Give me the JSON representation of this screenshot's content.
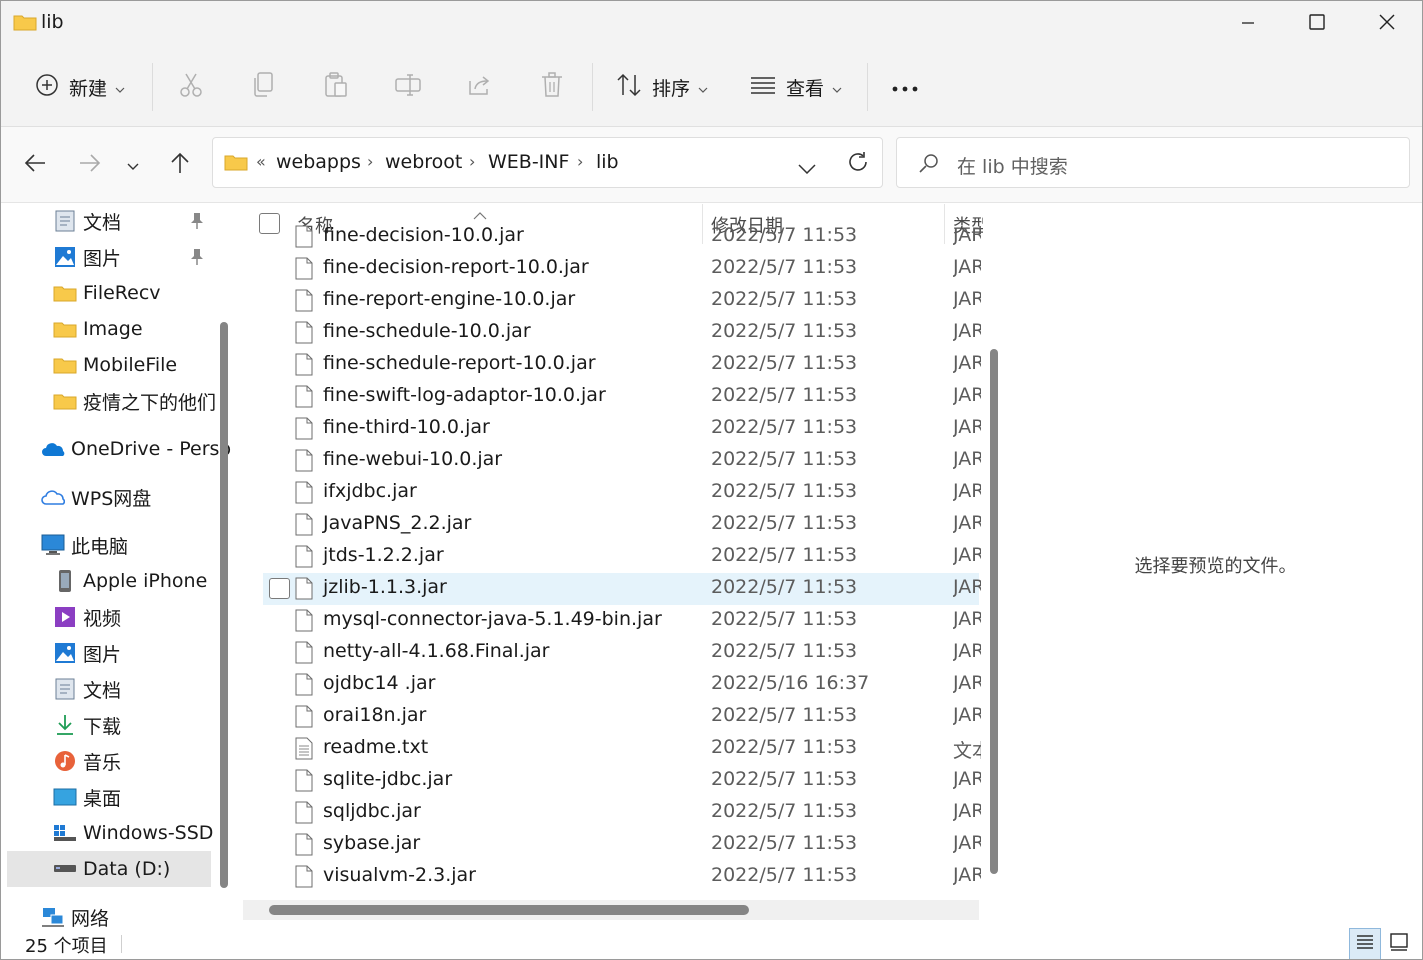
{
  "window": {
    "title": "lib"
  },
  "toolbar": {
    "new_label": "新建",
    "sort_label": "排序",
    "view_label": "查看"
  },
  "address": {
    "overflow": "«",
    "crumbs": [
      "webapps",
      "webroot",
      "WEB-INF",
      "lib"
    ]
  },
  "search": {
    "placeholder": "在 lib 中搜索"
  },
  "nav": {
    "items": [
      {
        "label": "文档",
        "icon": "documents-icon",
        "pinned": true
      },
      {
        "label": "图片",
        "icon": "pictures-icon",
        "pinned": true
      },
      {
        "label": "FileRecv",
        "icon": "folder-icon"
      },
      {
        "label": "Image",
        "icon": "folder-icon"
      },
      {
        "label": "MobileFile",
        "icon": "folder-icon"
      },
      {
        "label": "疫情之下的他们",
        "icon": "folder-icon"
      },
      {
        "label": "OneDrive - Perso",
        "icon": "onedrive-icon"
      },
      {
        "label": "WPS网盘",
        "icon": "wps-cloud-icon"
      },
      {
        "label": "此电脑",
        "icon": "this-pc-icon"
      },
      {
        "label": "Apple iPhone",
        "icon": "iphone-icon"
      },
      {
        "label": "视频",
        "icon": "videos-icon"
      },
      {
        "label": "图片",
        "icon": "pictures-icon"
      },
      {
        "label": "文档",
        "icon": "documents-icon"
      },
      {
        "label": "下载",
        "icon": "downloads-icon"
      },
      {
        "label": "音乐",
        "icon": "music-icon"
      },
      {
        "label": "桌面",
        "icon": "desktop-icon"
      },
      {
        "label": "Windows-SSD (",
        "icon": "windows-drive-icon"
      },
      {
        "label": "Data (D:)",
        "icon": "drive-icon",
        "selected": true
      },
      {
        "label": "网络",
        "icon": "network-icon"
      }
    ]
  },
  "list": {
    "columns": {
      "name": "名称",
      "date": "修改日期",
      "type": "类型"
    },
    "rows": [
      {
        "name": "fine-decision-10.0.jar",
        "date": "2022/5/7 11:53",
        "type": "JAR",
        "icon": "file-icon"
      },
      {
        "name": "fine-decision-report-10.0.jar",
        "date": "2022/5/7 11:53",
        "type": "JAR",
        "icon": "file-icon"
      },
      {
        "name": "fine-report-engine-10.0.jar",
        "date": "2022/5/7 11:53",
        "type": "JAR",
        "icon": "file-icon"
      },
      {
        "name": "fine-schedule-10.0.jar",
        "date": "2022/5/7 11:53",
        "type": "JAR",
        "icon": "file-icon"
      },
      {
        "name": "fine-schedule-report-10.0.jar",
        "date": "2022/5/7 11:53",
        "type": "JAR",
        "icon": "file-icon"
      },
      {
        "name": "fine-swift-log-adaptor-10.0.jar",
        "date": "2022/5/7 11:53",
        "type": "JAR",
        "icon": "file-icon"
      },
      {
        "name": "fine-third-10.0.jar",
        "date": "2022/5/7 11:53",
        "type": "JAR",
        "icon": "file-icon"
      },
      {
        "name": "fine-webui-10.0.jar",
        "date": "2022/5/7 11:53",
        "type": "JAR",
        "icon": "file-icon"
      },
      {
        "name": "ifxjdbc.jar",
        "date": "2022/5/7 11:53",
        "type": "JAR",
        "icon": "file-icon"
      },
      {
        "name": "JavaPNS_2.2.jar",
        "date": "2022/5/7 11:53",
        "type": "JAR",
        "icon": "file-icon"
      },
      {
        "name": "jtds-1.2.2.jar",
        "date": "2022/5/7 11:53",
        "type": "JAR",
        "icon": "file-icon"
      },
      {
        "name": "jzlib-1.1.3.jar",
        "date": "2022/5/7 11:53",
        "type": "JAR",
        "icon": "file-icon",
        "hover": true
      },
      {
        "name": "mysql-connector-java-5.1.49-bin.jar",
        "date": "2022/5/7 11:53",
        "type": "JAR",
        "icon": "file-icon"
      },
      {
        "name": "netty-all-4.1.68.Final.jar",
        "date": "2022/5/7 11:53",
        "type": "JAR",
        "icon": "file-icon"
      },
      {
        "name": "ojdbc14 .jar",
        "date": "2022/5/16 16:37",
        "type": "JAR",
        "icon": "file-icon"
      },
      {
        "name": "orai18n.jar",
        "date": "2022/5/7 11:53",
        "type": "JAR",
        "icon": "file-icon"
      },
      {
        "name": "readme.txt",
        "date": "2022/5/7 11:53",
        "type": "文本",
        "icon": "text-file-icon"
      },
      {
        "name": "sqlite-jdbc.jar",
        "date": "2022/5/7 11:53",
        "type": "JAR",
        "icon": "file-icon"
      },
      {
        "name": "sqljdbc.jar",
        "date": "2022/5/7 11:53",
        "type": "JAR",
        "icon": "file-icon"
      },
      {
        "name": "sybase.jar",
        "date": "2022/5/7 11:53",
        "type": "JAR",
        "icon": "file-icon"
      },
      {
        "name": "visualvm-2.3.jar",
        "date": "2022/5/7 11:53",
        "type": "JAR",
        "icon": "file-icon"
      }
    ]
  },
  "preview": {
    "message": "选择要预览的文件。"
  },
  "status": {
    "count": "25 个项目"
  },
  "colors": {
    "accent": "#0067c0",
    "folder": "#f8c94a",
    "hover": "#e5f3fb"
  }
}
